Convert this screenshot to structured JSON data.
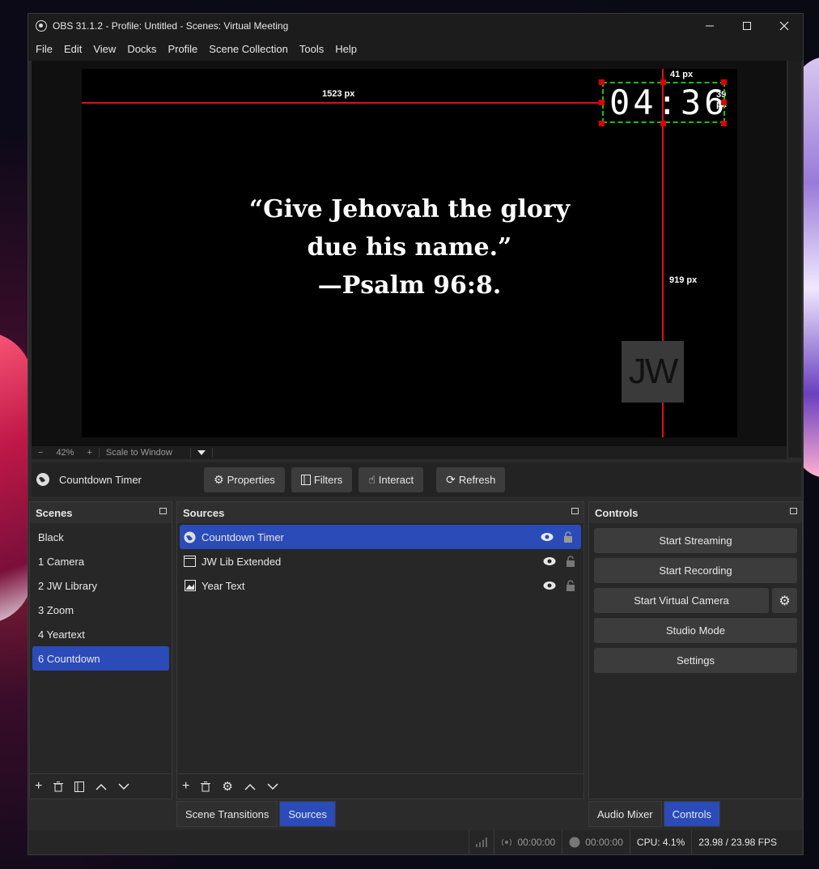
{
  "window": {
    "title": "OBS 31.1.2 - Profile: Untitled - Scenes: Virtual Meeting"
  },
  "menu": [
    "File",
    "Edit",
    "View",
    "Docks",
    "Profile",
    "Scene Collection",
    "Tools",
    "Help"
  ],
  "preview": {
    "guide_h_label": "1523 px",
    "guide_top_label": "41 px",
    "guide_right_label": "39 px",
    "guide_v_label": "919 px",
    "timer": "04:36",
    "quote_lines": [
      "“Give Jehovah the glory",
      "due his name.”",
      "—Psalm 96:8."
    ],
    "logo_text": "JW",
    "zoom_minus": "−",
    "zoom_level": "42%",
    "zoom_plus": "+",
    "scale_mode": "Scale to Window"
  },
  "context": {
    "source_name": "Countdown Timer",
    "buttons": {
      "properties": "Properties",
      "filters": "Filters",
      "interact": "Interact",
      "refresh": "Refresh"
    }
  },
  "scenes": {
    "title": "Scenes",
    "items": [
      "Black",
      "1 Camera",
      "2 JW Library",
      "3 Zoom",
      "4 Yeartext",
      "6 Countdown"
    ],
    "selected": "6 Countdown"
  },
  "sources": {
    "title": "Sources",
    "items": [
      {
        "name": "Countdown Timer",
        "icon": "globe-icon",
        "selected": true
      },
      {
        "name": "JW Lib Extended",
        "icon": "window-icon",
        "selected": false
      },
      {
        "name": "Year Text",
        "icon": "image-icon",
        "selected": false
      }
    ]
  },
  "controls": {
    "title": "Controls",
    "start_streaming": "Start Streaming",
    "start_recording": "Start Recording",
    "start_virtual_camera": "Start Virtual Camera",
    "studio_mode": "Studio Mode",
    "settings": "Settings"
  },
  "tabs": {
    "scene_transitions": "Scene Transitions",
    "sources": "Sources",
    "audio_mixer": "Audio Mixer",
    "controls": "Controls"
  },
  "status": {
    "stream_time": "00:00:00",
    "record_time": "00:00:00",
    "cpu": "CPU: 4.1%",
    "fps": "23.98 / 23.98 FPS"
  },
  "colors": {
    "accent": "#2a4bb8",
    "guide": "#e01010",
    "selection_border": "#18c018"
  }
}
